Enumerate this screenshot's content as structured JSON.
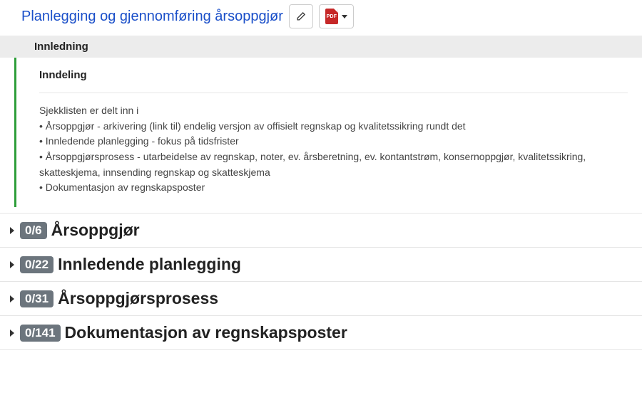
{
  "header": {
    "title": "Planlegging og gjennomføring årsoppgjør",
    "pdf_label": "PDF"
  },
  "intro_bar": "Innledning",
  "info": {
    "subheading": "Inndeling",
    "lead": "Sjekklisten er delt inn i",
    "bullets": [
      "Årsoppgjør - arkivering (link til) endelig versjon av offisielt regnskap og kvalitetssikring rundt det",
      "Innledende planlegging - fokus på tidsfrister",
      "Årsoppgjørsprosess - utarbeidelse av regnskap, noter, ev. årsberetning, ev. kontantstrøm, konsernoppgjør, kvalitetssikring, skatteskjema, innsending regnskap og skatteskjema",
      "Dokumentasjon av regnskapsposter"
    ]
  },
  "sections": [
    {
      "count": "0/6",
      "title": "Årsoppgjør"
    },
    {
      "count": "0/22",
      "title": "Innledende planlegging"
    },
    {
      "count": "0/31",
      "title": "Årsoppgjørsprosess"
    },
    {
      "count": "0/141",
      "title": "Dokumentasjon av regnskapsposter"
    }
  ]
}
